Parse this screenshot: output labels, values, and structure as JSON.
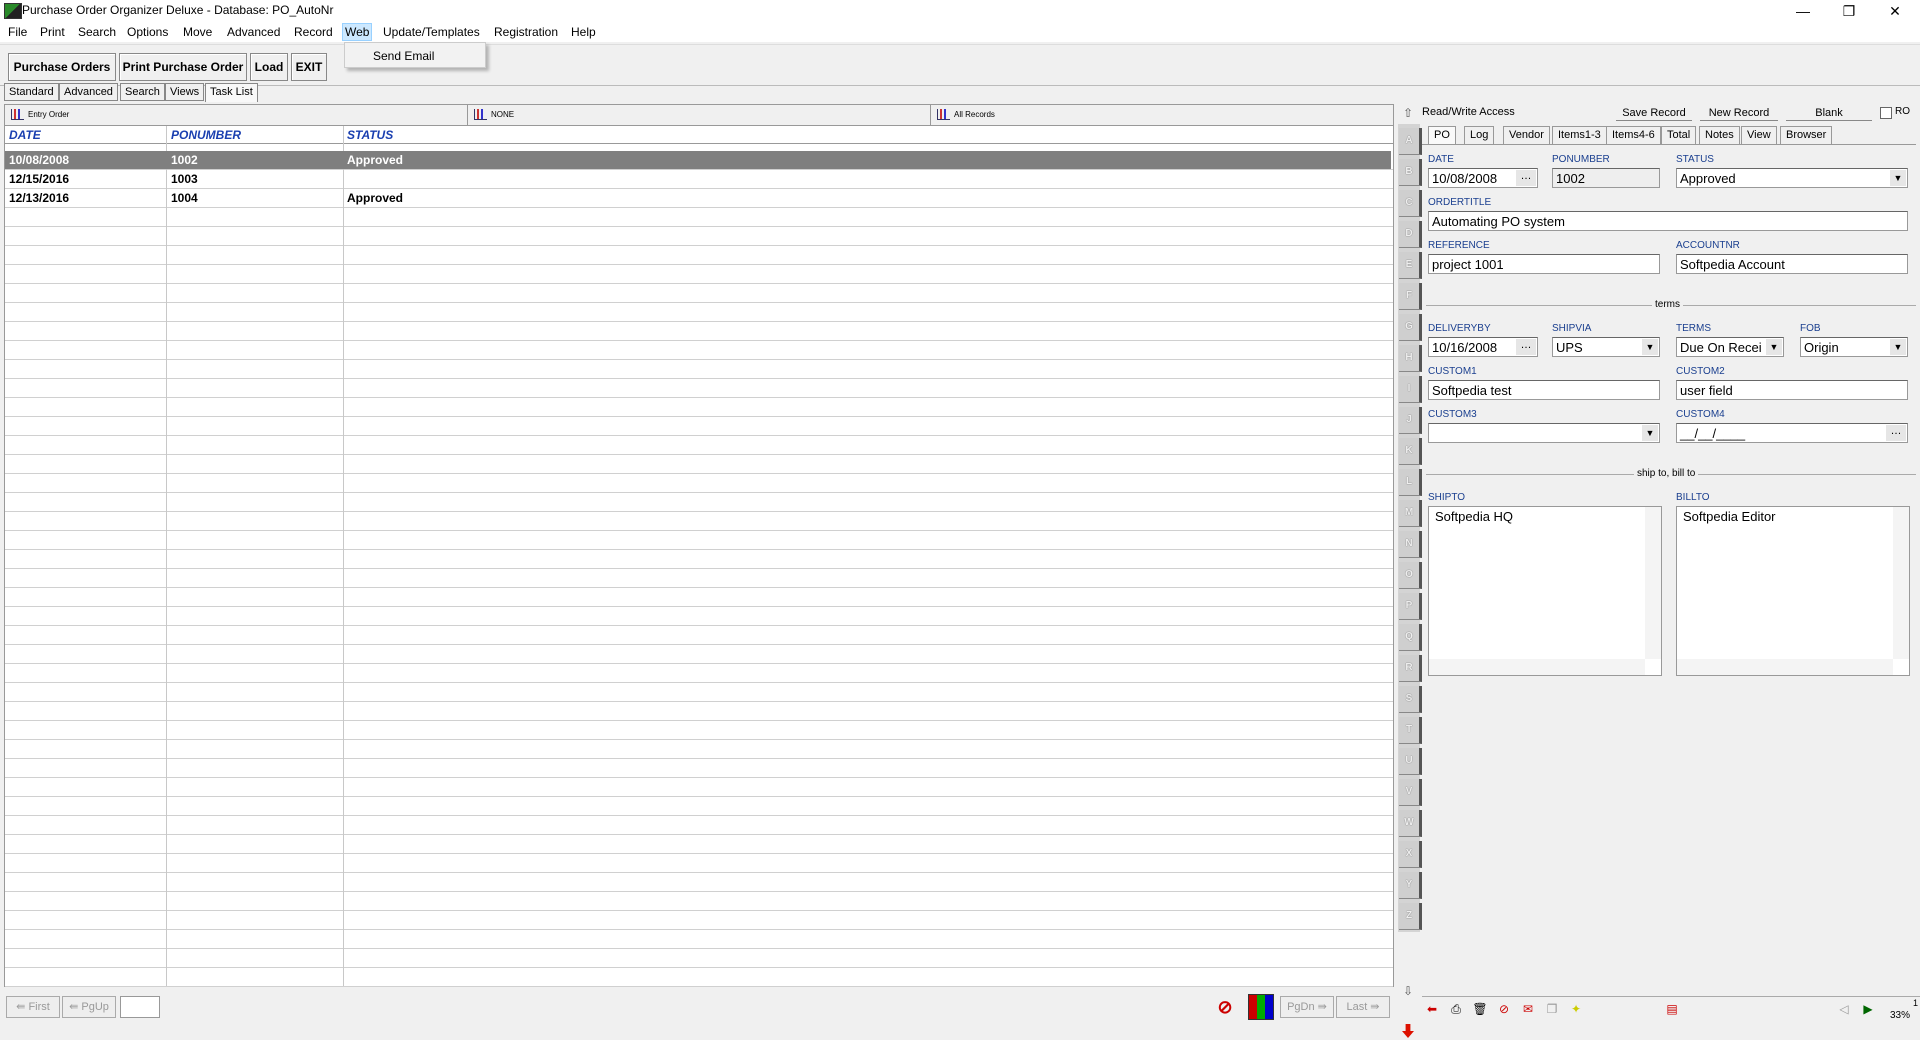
{
  "window": {
    "title": "Purchase Order Organizer Deluxe - Database: PO_AutoNr",
    "minimize": "—",
    "restore": "❐",
    "close": "✕"
  },
  "menu": [
    "File",
    "Print",
    "Search",
    "Options",
    "Move",
    "Advanced",
    "Record",
    "Web",
    "Update/Templates",
    "Registration",
    "Help"
  ],
  "web_dropdown": {
    "item": "Send Email"
  },
  "toolbar": {
    "purchase_orders": "Purchase Orders",
    "print_po": "Print Purchase Order",
    "load": "Load",
    "exit": "EXIT"
  },
  "view_tabs": [
    "Standard",
    "Advanced",
    "Search",
    "Views",
    "Task List"
  ],
  "sortbar": {
    "sort1": "Entry Order",
    "sort2": "NONE",
    "filter": "All Records"
  },
  "columns": [
    "DATE",
    "PONUMBER",
    "STATUS"
  ],
  "rows": [
    {
      "date": "10/08/2008",
      "ponumber": "1002",
      "status": "Approved"
    },
    {
      "date": "12/15/2016",
      "ponumber": "1003",
      "status": ""
    },
    {
      "date": "12/13/2016",
      "ponumber": "1004",
      "status": "Approved"
    }
  ],
  "nav": {
    "first": "First",
    "pgup": "PgUp",
    "pgdn": "PgDn",
    "last": "Last",
    "page_input": ""
  },
  "letters": [
    "A",
    "B",
    "C",
    "D",
    "E",
    "F",
    "G",
    "H",
    "I",
    "J",
    "K",
    "L",
    "M",
    "N",
    "O",
    "P",
    "Q",
    "R",
    "S",
    "T",
    "U",
    "V",
    "W",
    "X",
    "Y",
    "Z"
  ],
  "detail": {
    "access": "Read/Write Access",
    "save_record": "Save Record",
    "new_record": "New Record",
    "blank": "Blank",
    "ro": "RO",
    "tabs": [
      "PO",
      "Log",
      "Vendor",
      "Items1-3",
      "Items4-6",
      "Total",
      "Notes",
      "View",
      "Browser"
    ],
    "fields": {
      "date_label": "DATE",
      "date": "10/08/2008",
      "ponumber_label": "PONUMBER",
      "ponumber": "1002",
      "status_label": "STATUS",
      "status": "Approved",
      "ordertitle_label": "ORDERTITLE",
      "ordertitle": "Automating PO system",
      "reference_label": "REFERENCE",
      "reference": "project 1001",
      "accountnr_label": "ACCOUNTNR",
      "accountnr": "Softpedia Account",
      "terms_section": "terms",
      "deliveryby_label": "DELIVERYBY",
      "deliveryby": "10/16/2008",
      "shipvia_label": "SHIPVIA",
      "shipvia": "UPS",
      "terms_label": "TERMS",
      "terms": "Due On Recei",
      "fob_label": "FOB",
      "fob": "Origin",
      "custom1_label": "CUSTOM1",
      "custom1": "Softpedia test",
      "custom2_label": "CUSTOM2",
      "custom2": "user field",
      "custom3_label": "CUSTOM3",
      "custom3": "",
      "custom4_label": "CUSTOM4",
      "custom4": "__/__/____",
      "shipbill_section": "ship to, bill to",
      "shipto_label": "SHIPTO",
      "shipto": "Softpedia HQ",
      "billto_label": "BILLTO",
      "billto": "Softpedia Editor"
    },
    "zoom": "33%",
    "zoom_page": "1"
  }
}
